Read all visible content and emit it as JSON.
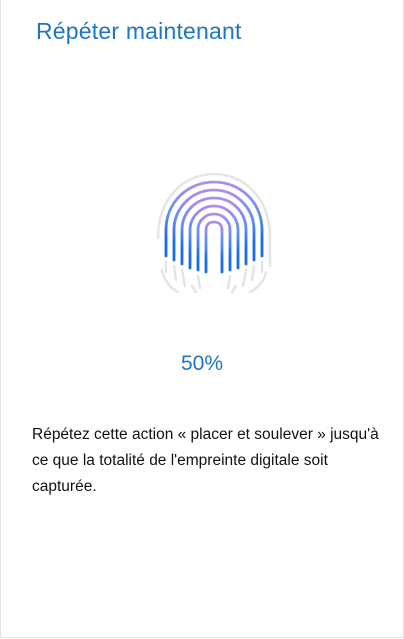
{
  "screen": {
    "title": "Répéter maintenant",
    "progress_text": "50%",
    "progress_value": 0.5,
    "instruction": "Répétez cette action « placer et soulever » jusqu'à ce que la totalité de l'empreinte digitale soit capturée."
  },
  "icon": {
    "name": "fingerprint-icon",
    "gradient_top": "#b18cf0",
    "gradient_bottom": "#1c6be3"
  },
  "colors": {
    "accent": "#1e74c8",
    "text": "#111111",
    "background": "#ffffff"
  }
}
